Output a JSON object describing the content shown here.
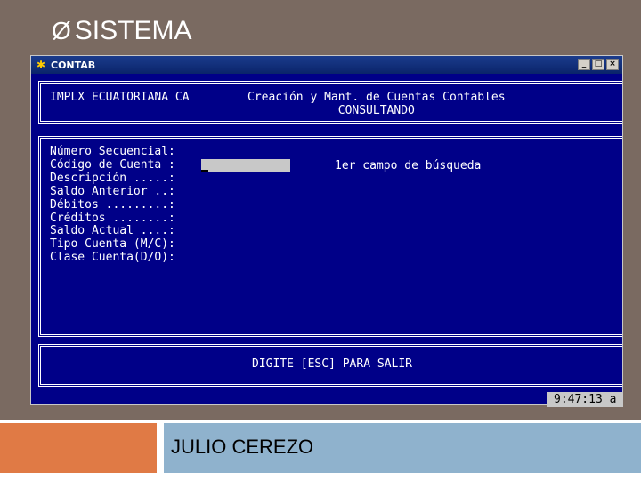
{
  "slide": {
    "bullet": "Ø",
    "title": "SISTEMA",
    "author": "JULIO CEREZO"
  },
  "window": {
    "title": "CONTAB",
    "icon": "app-star-icon",
    "buttons": {
      "minimize": "_",
      "maximize": "□",
      "close": "×"
    }
  },
  "header": {
    "company": "IMPLX ECUATORIANA CA",
    "screen_title": "Creación y Mant. de Cuentas Contables",
    "mode": "CONSULTANDO"
  },
  "form": {
    "fields": [
      "Número Secuencial:",
      "Código de Cuenta :",
      "Descripción .....:",
      "Saldo Anterior ..:",
      "Débitos .........:",
      "Créditos ........:",
      "Saldo Actual ....:",
      "Tipo Cuenta (M/C):",
      "Clase Cuenta(D/O):"
    ],
    "code_value": "",
    "hint": "1er campo de búsqueda"
  },
  "footer": {
    "instruction": "DIGITE [ESC] PARA SALIR"
  },
  "clock": "9:47:13 a",
  "colors": {
    "background": "#7a6a61",
    "dos_blue": "#000088",
    "accent_orange": "#e07a45",
    "accent_blue": "#8fb2cd"
  }
}
